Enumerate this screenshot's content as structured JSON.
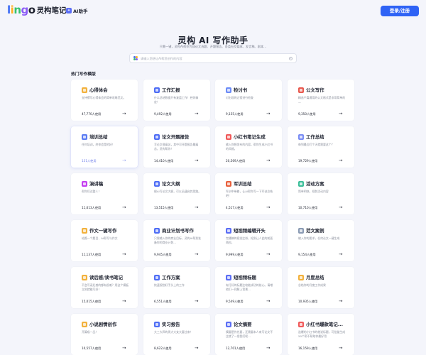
{
  "header": {
    "logo_letters": [
      "l",
      "i",
      "n",
      "g",
      "o"
    ],
    "logo_text": "灵构笔记",
    "nav_ai_label": "AI助手",
    "login_label": "登录/注册"
  },
  "hero": {
    "title": "灵构 AI 写作助手",
    "subtitle": "只需一键，灵构AI帮你完成论文选题、开题报告、各类社交媒体、发言稿、剧本…",
    "search_placeholder": "请输入您想让AI帮您创作的内容",
    "search_value": ""
  },
  "section_title": "热门写作模版",
  "cards": [
    {
      "title": "心得体会",
      "icon": "notes-icon",
      "color": "#f2b13c",
      "desc": "支持撰写心得体会的简单攻略范文。",
      "count": "47,770人使用"
    },
    {
      "title": "工作汇报",
      "icon": "briefcase-icon",
      "color": "#4f6ef5",
      "desc": "什么总结数据只有复盘工作！经你搞定！",
      "count": "9,492人使用"
    },
    {
      "title": "检讨书",
      "icon": "pen-icon",
      "color": "#6d8cf7",
      "desc": "对出现的过错进行检查",
      "count": "9,155人使用"
    },
    {
      "title": "公文写作",
      "icon": "document-icon",
      "color": "#e85a4f",
      "desc": "精选千篇通用的公文格式是非常简单的—",
      "count": "9,350人使用"
    },
    {
      "title": "培训总结",
      "icon": "training-icon",
      "color": "#5b7cf3",
      "desc": "任何培训，终你会是的好！",
      "count": "131人使用",
      "active": true
    },
    {
      "title": "论文开题报告",
      "icon": "report-icon",
      "color": "#4f6ef5",
      "desc": "写论文很痛苦，其中可开题报告最痛苦，灵构帮你！",
      "count": "14,410人使用"
    },
    {
      "title": "小红书笔记生成",
      "icon": "redbook-icon",
      "color": "#f05a5a",
      "desc": "输入你想发布的内容，帮你生成小红书的风格。",
      "count": "20,569人使用"
    },
    {
      "title": "工作总结",
      "icon": "summary-icon",
      "color": "#7b8ef5",
      "desc": "每到最后们个天就需要这个？",
      "count": "19,729人使用"
    },
    {
      "title": "演讲稿",
      "icon": "speech-icon",
      "color": "#c43df0",
      "desc": "帮你们达整人！",
      "count": "11,613人使用"
    },
    {
      "title": "论文大纲",
      "icon": "outline-icon",
      "color": "#4f6ef5",
      "desc": "根AI写论文大纲，可以迅速启其思路。",
      "count": "13,515人使用"
    },
    {
      "title": "军训总结",
      "icon": "military-icon",
      "color": "#e8603c",
      "desc": "军训中带着，让AI帮你写一下军训总结吧！",
      "count": "4,517人使用"
    },
    {
      "title": "活动方案",
      "icon": "megaphone-icon",
      "color": "#3dbf9a",
      "desc": "简单明快，规划活动内容",
      "count": "10,710人使用"
    },
    {
      "title": "作文一键写作",
      "icon": "composition-icon",
      "color": "#f2b13c",
      "desc": "给篇一个题目、AI帮写与作文",
      "count": "11,137人使用"
    },
    {
      "title": "商业计划书写作",
      "icon": "business-plan-icon",
      "color": "#4f6ef5",
      "desc": "只需输入你的商业目标，灵构AI帮到准备你的商业计划...",
      "count": "9,945人使用"
    },
    {
      "title": "短视频编辑开头",
      "icon": "video-icon",
      "color": "#5b6ef5",
      "desc": "完播稿的视觉比拟，抢到让人此的前面两秒。",
      "count": "9,999人使用"
    },
    {
      "title": "范文案例",
      "icon": "sample-icon",
      "color": "#8b9bb4",
      "desc": "输入你的要求，任何论文一键生成",
      "count": "9,154人使用"
    },
    {
      "title": "读后感/读书笔记",
      "icon": "book-icon",
      "color": "#f2b13c",
      "desc": "不会写读后感的都有很难？用这个模板立刻就能写好！",
      "count": "15,015人使用"
    },
    {
      "title": "工作方案",
      "icon": "plan-icon",
      "color": "#4f6ef5",
      "desc": "快速规划好手头上的工作",
      "count": "6,551人使用"
    },
    {
      "title": "短视频标题",
      "icon": "video-title-icon",
      "color": "#5b6ef5",
      "desc": "有打好的标题比较能成功的核心。请增他们一同解上背景...",
      "count": "9,549人使用"
    },
    {
      "title": "月度总结",
      "icon": "calendar-icon",
      "color": "#f2b13c",
      "desc": "总结你的月度工作成果",
      "count": "10,935人使用"
    },
    {
      "title": "小说剧情创作",
      "icon": "story-icon",
      "color": "#f2b13c",
      "desc": "开篇吸一品！",
      "count": "10,557人使用"
    },
    {
      "title": "实习报告",
      "icon": "internship-icon",
      "color": "#4f6ef5",
      "desc": "大三大四的男大大女大要过来！",
      "count": "8,622人使用"
    },
    {
      "title": "论文摘要",
      "icon": "abstract-icon",
      "color": "#5b6ef5",
      "desc": "摘要是作先要，还需要本人来写论文不比就了一把我们呢...",
      "count": "12,701人使用"
    },
    {
      "title": "小红书爆款笔记...",
      "icon": "hot-note-icon",
      "color": "#f05a5a",
      "desc": "选爆的小红书的就说标题，可批量生成50个帮不帮助你最好用",
      "count": "16,159人使用"
    }
  ]
}
